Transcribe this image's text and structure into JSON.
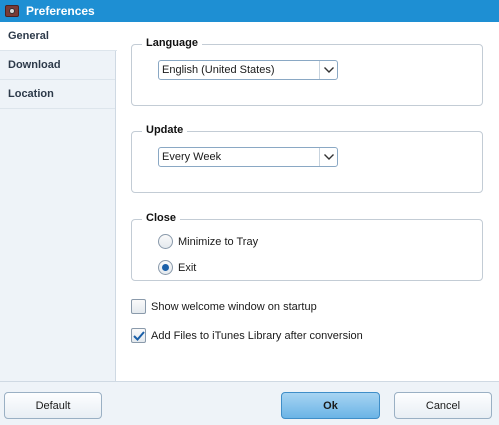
{
  "window": {
    "title": "Preferences",
    "icon": "app-camera-icon",
    "accent": "#1e8fd3"
  },
  "sidebar": {
    "items": [
      {
        "label": "General",
        "active": true
      },
      {
        "label": "Download",
        "active": false
      },
      {
        "label": "Location",
        "active": false
      }
    ]
  },
  "language": {
    "title": "Language",
    "selected": "English (United States)"
  },
  "update": {
    "title": "Update",
    "selected": "Every Week"
  },
  "close": {
    "title": "Close",
    "options": [
      {
        "label": "Minimize to Tray",
        "selected": false
      },
      {
        "label": "Exit",
        "selected": true
      }
    ]
  },
  "checkboxes": [
    {
      "label": "Show welcome window on startup",
      "checked": false
    },
    {
      "label": "Add Files to iTunes Library after conversion",
      "checked": true
    }
  ],
  "buttons": {
    "default": "Default",
    "ok": "Ok",
    "cancel": "Cancel"
  }
}
